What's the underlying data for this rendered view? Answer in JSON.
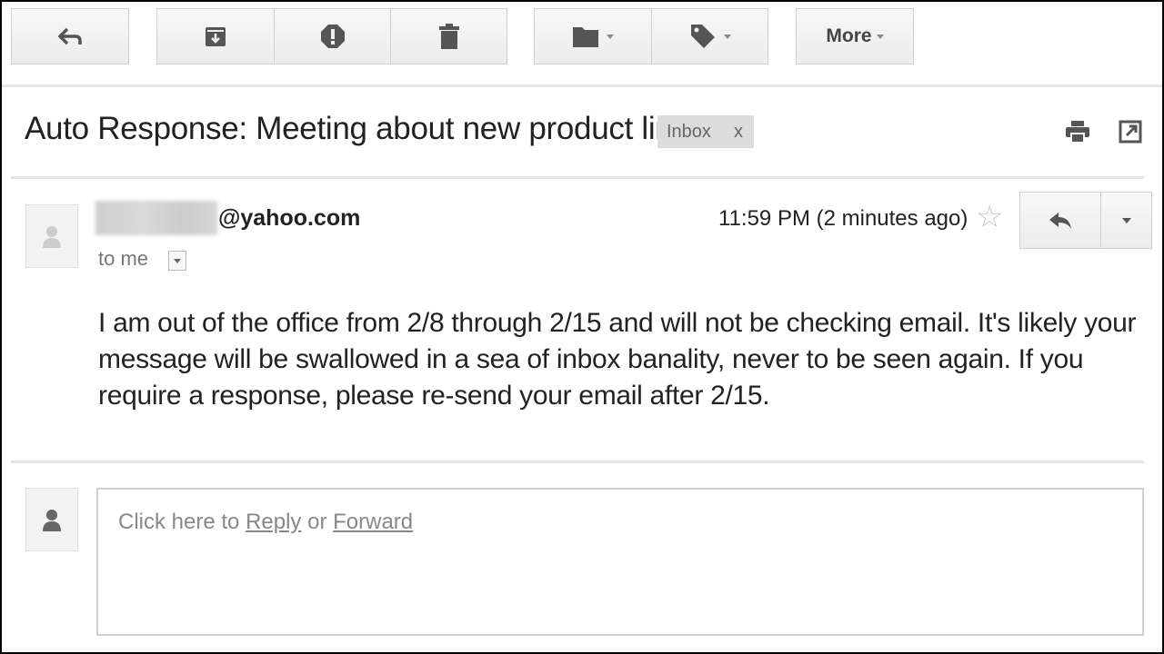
{
  "toolbar": {
    "more_label": "More"
  },
  "subject": {
    "title": "Auto Response: Meeting about new product line",
    "label": "Inbox",
    "label_close": "x"
  },
  "message": {
    "sender_domain": "@yahoo.com",
    "to_label": "to me",
    "time": "11:59 PM (2 minutes ago)",
    "body": "I am out of the office from 2/8 through 2/15 and will not be checking email. It's likely your message will be swallowed in a sea of inbox banality, never to be seen again. If you require a response, please re-send your email after 2/15."
  },
  "reply": {
    "prefix": "Click here to ",
    "reply_link": "Reply",
    "middle": " or ",
    "forward_link": "Forward"
  },
  "colors": {
    "button_bg": "#f5f5f5",
    "icon": "#555555",
    "label_chip": "#dcdcdc",
    "border": "#d0d0d0"
  },
  "icons": [
    "back-arrow-icon",
    "archive-icon",
    "report-spam-icon",
    "delete-icon",
    "folder-icon",
    "label-tag-icon",
    "print-icon",
    "new-window-icon",
    "avatar-icon",
    "star-icon",
    "reply-icon",
    "chevron-down-icon"
  ]
}
